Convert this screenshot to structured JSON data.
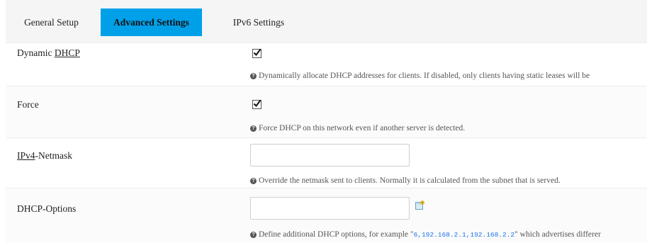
{
  "tabs": [
    {
      "label": "General Setup",
      "active": false
    },
    {
      "label": "Advanced Settings",
      "active": true
    },
    {
      "label": "IPv6 Settings",
      "active": false
    }
  ],
  "fields": {
    "dynamic_dhcp": {
      "label_prefix": "Dynamic ",
      "label_abbr": "DHCP",
      "checked": true,
      "help": "Dynamically allocate DHCP addresses for clients. If disabled, only clients having static leases will be"
    },
    "force": {
      "label": "Force",
      "checked": true,
      "help": "Force DHCP on this network even if another server is detected."
    },
    "ipv4_netmask": {
      "label_abbr": "IPv4",
      "label_suffix": "-Netmask",
      "value": "",
      "help": "Override the netmask sent to clients. Normally it is calculated from the subnet that is served."
    },
    "dhcp_options": {
      "label": "DHCP-Options",
      "value": "",
      "help_prefix": "Define additional DHCP options, for example \"",
      "help_code": "6,192.168.2.1,192.168.2.2",
      "help_suffix": "\" which advertises differer"
    }
  },
  "help_icon_glyph": "?",
  "colors": {
    "active_tab": "#00a0e9",
    "code_text": "#1a73e8"
  }
}
